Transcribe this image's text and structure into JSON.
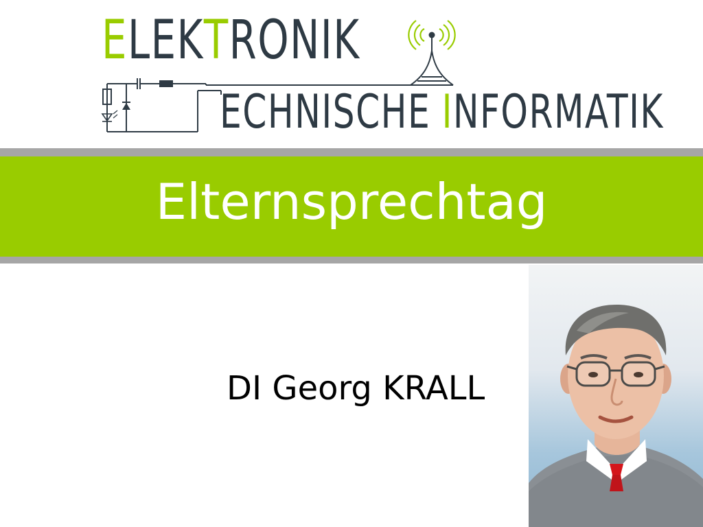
{
  "logo": {
    "line1_accent": "E",
    "line1_rest_a": "LEK",
    "line1_accent2": "T",
    "line1_rest_b": "RONIK",
    "line2_rest_a": "ECHNISCHE",
    "line2_accent": "I",
    "line2_rest_b": "NFORMATIK",
    "colors": {
      "accent": "#99cc00",
      "dark": "#2e3a44"
    }
  },
  "banner": {
    "title": "Elternsprechtag",
    "colors": {
      "green": "#99cc00",
      "grey": "#a6a6a6",
      "text": "#ffffff"
    }
  },
  "presenter": {
    "name": "DI Georg KRALL"
  },
  "icons": [
    "radio-tower-icon",
    "circuit-diagram-icon",
    "diode-icon",
    "led-icon",
    "resistor-icon",
    "capacitor-icon"
  ]
}
